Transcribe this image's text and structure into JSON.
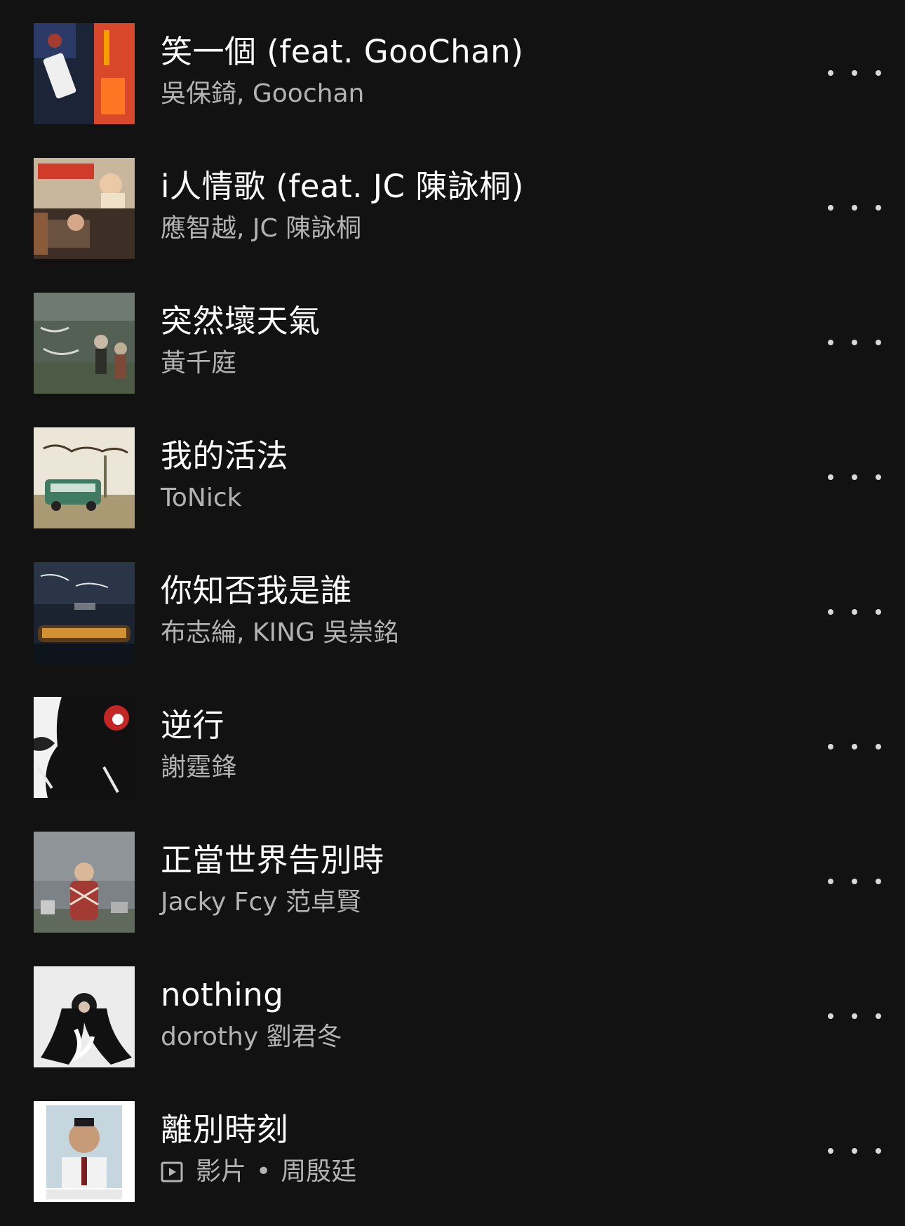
{
  "tracks": [
    {
      "title": "笑一個 (feat. GooChan)",
      "artist": "吳保錡, Goochan",
      "more_icon": "more-horizontal-icon"
    },
    {
      "title": "i人情歌 (feat. JC 陳詠桐)",
      "artist": "應智越, JC 陳詠桐",
      "more_icon": "more-horizontal-icon"
    },
    {
      "title": "突然壞天氣",
      "artist": "黃千庭",
      "more_icon": "more-horizontal-icon"
    },
    {
      "title": "我的活法",
      "artist": "ToNick",
      "more_icon": "more-horizontal-icon"
    },
    {
      "title": "你知否我是誰",
      "artist": "布志綸, KING 吳崇銘",
      "more_icon": "more-horizontal-icon"
    },
    {
      "title": "逆行",
      "artist": "謝霆鋒",
      "more_icon": "more-horizontal-icon"
    },
    {
      "title": "正當世界告別時",
      "artist": "Jacky Fcy 范卓賢",
      "more_icon": "more-horizontal-icon"
    },
    {
      "title": "nothing",
      "artist": "dorothy 劉君冬",
      "more_icon": "more-horizontal-icon"
    },
    {
      "title": "離別時刻",
      "artist": "周殷廷",
      "type_label": "影片",
      "separator": "•",
      "type_icon": "video-icon",
      "more_icon": "more-horizontal-icon"
    }
  ],
  "colors": {
    "background": "#121212",
    "title": "#ffffff",
    "subtitle": "#b3b3b3",
    "more_dots": "#d9d9d9"
  }
}
